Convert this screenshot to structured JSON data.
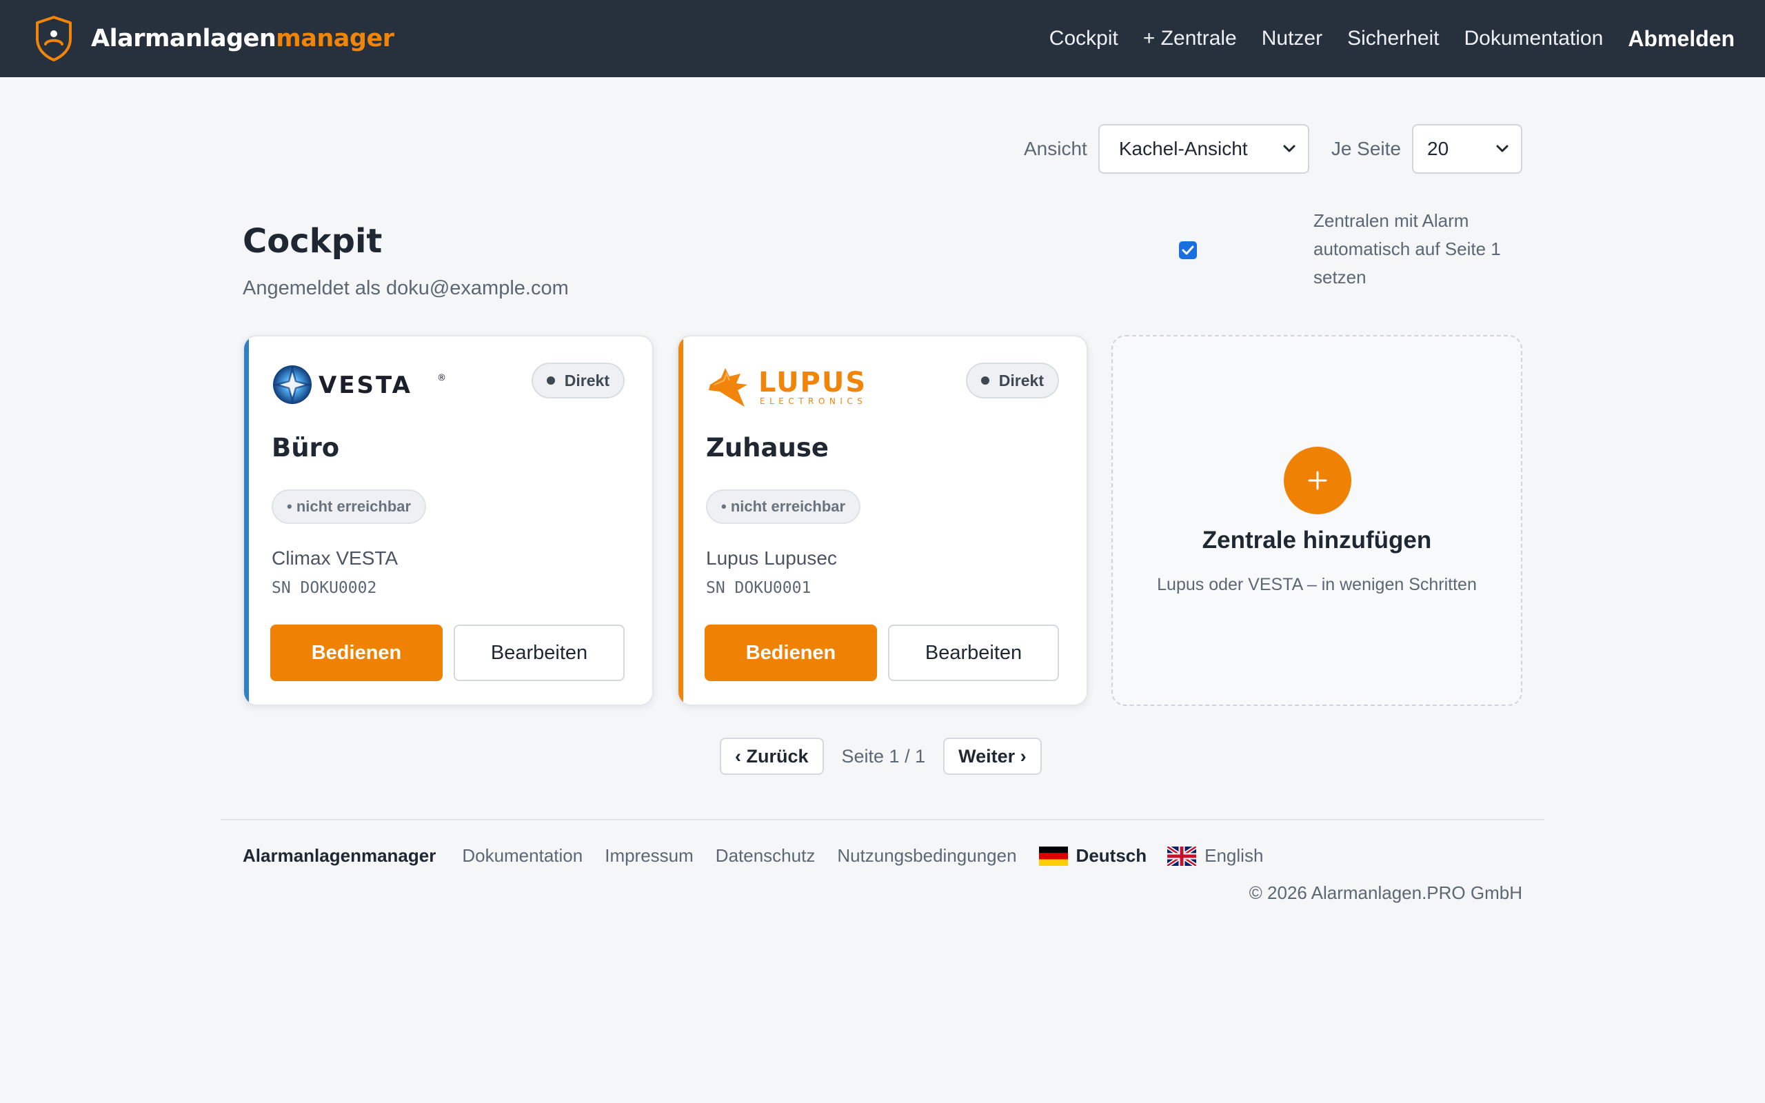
{
  "nav": {
    "brand_white": "Alarmanlagen",
    "brand_orange": "manager",
    "links": [
      "Cockpit",
      "+ Zentrale",
      "Nutzer",
      "Sicherheit",
      "Dokumentation"
    ],
    "logout": "Abmelden"
  },
  "controls": {
    "view_label": "Ansicht",
    "view_value": "Kachel-Ansicht",
    "perpage_label": "Je Seite",
    "perpage_value": "20"
  },
  "header": {
    "title": "Cockpit",
    "logged_in": "Angemeldet als doku@example.com",
    "alarm_option": "Zentralen mit Alarm automatisch auf Seite 1 setzen",
    "alarm_checked": true
  },
  "cards": [
    {
      "brand_logo": "VESTA",
      "connection": "Direkt",
      "name": "Büro",
      "status": "• nicht erreichbar",
      "model": "Climax VESTA",
      "serial": "SN DOKU0002",
      "primary": "Bedienen",
      "secondary": "Bearbeiten",
      "accent": "#2e7fc4"
    },
    {
      "brand_logo": "LUPUS",
      "brand_logo_sub": "ELECTRONICS",
      "connection": "Direkt",
      "name": "Zuhause",
      "status": "• nicht erreichbar",
      "model": "Lupus Lupusec",
      "serial": "SN DOKU0001",
      "primary": "Bedienen",
      "secondary": "Bearbeiten",
      "accent": "#f0850a"
    }
  ],
  "add_card": {
    "title": "Zentrale hinzufügen",
    "subtitle": "Lupus oder VESTA – in wenigen Schritten"
  },
  "pagination": {
    "prev": "‹ Zurück",
    "info": "Seite 1 / 1",
    "next": "Weiter ›"
  },
  "footer": {
    "brand": "Alarmanlagenmanager",
    "links": [
      "Dokumentation",
      "Impressum",
      "Datenschutz",
      "Nutzungsbedingungen"
    ],
    "lang_de": "Deutsch",
    "lang_en": "English",
    "copyright": "© 2026 Alarmanlagen.PRO GmbH"
  },
  "colors": {
    "navbar": "#27303d",
    "accent": "#ef8205",
    "background": "#f5f6f8"
  }
}
